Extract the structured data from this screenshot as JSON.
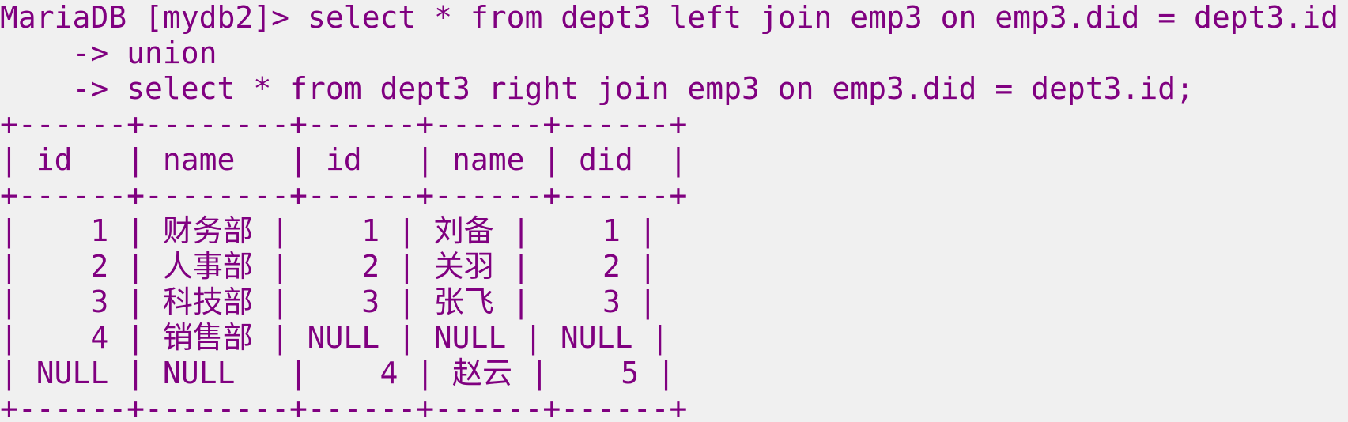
{
  "terminal": {
    "prompt": "MariaDB [mydb2]>",
    "query_line1": "select * from dept3 left join emp3 on emp3.did = dept3.id",
    "query_line2_prefix": "    ->",
    "query_line2": "union",
    "query_line3_prefix": "    ->",
    "query_line3": "select * from dept3 right join emp3 on emp3.did = dept3.id;",
    "border_line": "+------+--------+------+------+------+",
    "headers": [
      "id",
      "name",
      "id",
      "name",
      "did"
    ],
    "rows": [
      [
        "1",
        "财务部",
        "1",
        "刘备",
        "1"
      ],
      [
        "2",
        "人事部",
        "2",
        "关羽",
        "2"
      ],
      [
        "3",
        "科技部",
        "3",
        "张飞",
        "3"
      ],
      [
        "4",
        "销售部",
        "NULL",
        "NULL",
        "NULL"
      ],
      [
        "NULL",
        "NULL",
        "4",
        "赵云",
        "5"
      ]
    ],
    "text_color": "#800080",
    "background_color": "#f0f0f0"
  }
}
